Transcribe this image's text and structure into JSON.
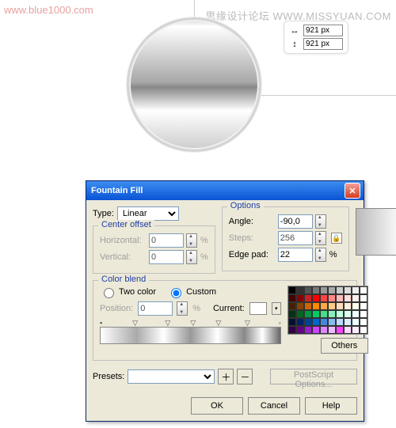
{
  "watermarks": {
    "left": "www.blue1000.com",
    "right": "思缘设计论坛  WWW.MISSYUAN.COM"
  },
  "dim": {
    "w": "921 px",
    "h": "921 px"
  },
  "dialog": {
    "title": "Fountain Fill",
    "type_label": "Type:",
    "type_value": "Linear",
    "center_offset": {
      "label": "Center offset",
      "horizontal_label": "Horizontal:",
      "horizontal_value": "0",
      "vertical_label": "Vertical:",
      "vertical_value": "0",
      "pct": "%"
    },
    "options": {
      "label": "Options",
      "angle_label": "Angle:",
      "angle_value": "-90,0",
      "steps_label": "Steps:",
      "steps_value": "256",
      "edge_label": "Edge pad:",
      "edge_value": "22",
      "pct": "%"
    },
    "color_blend": {
      "label": "Color blend",
      "two_color": "Two color",
      "custom": "Custom",
      "position_label": "Position:",
      "position_value": "0",
      "pct": "%",
      "current_label": "Current:",
      "others": "Others"
    },
    "presets": {
      "label": "Presets:",
      "postscript": "PostScript Options..."
    },
    "buttons": {
      "ok": "OK",
      "cancel": "Cancel",
      "help": "Help"
    }
  },
  "palette_colors": [
    "#000",
    "#333",
    "#555",
    "#777",
    "#999",
    "#aaa",
    "#ccc",
    "#ddd",
    "#eee",
    "#fff",
    "#400",
    "#800",
    "#c22",
    "#f00",
    "#f44",
    "#f88",
    "#fbb",
    "#fdd",
    "#fee",
    "#fff",
    "#420",
    "#840",
    "#c60",
    "#f80",
    "#fa4",
    "#fc8",
    "#fdb",
    "#fed",
    "#ffe",
    "#fff",
    "#031",
    "#062",
    "#094",
    "#0c6",
    "#4d8",
    "#8eb",
    "#bfd",
    "#dfe",
    "#eff",
    "#fff",
    "#013",
    "#026",
    "#049",
    "#06c",
    "#48d",
    "#8be",
    "#bdf",
    "#def",
    "#eff",
    "#fff",
    "#304",
    "#608",
    "#92c",
    "#c4f",
    "#d8f",
    "#ebf",
    "#f4f",
    "#fdf",
    "#fef",
    "#fff"
  ]
}
